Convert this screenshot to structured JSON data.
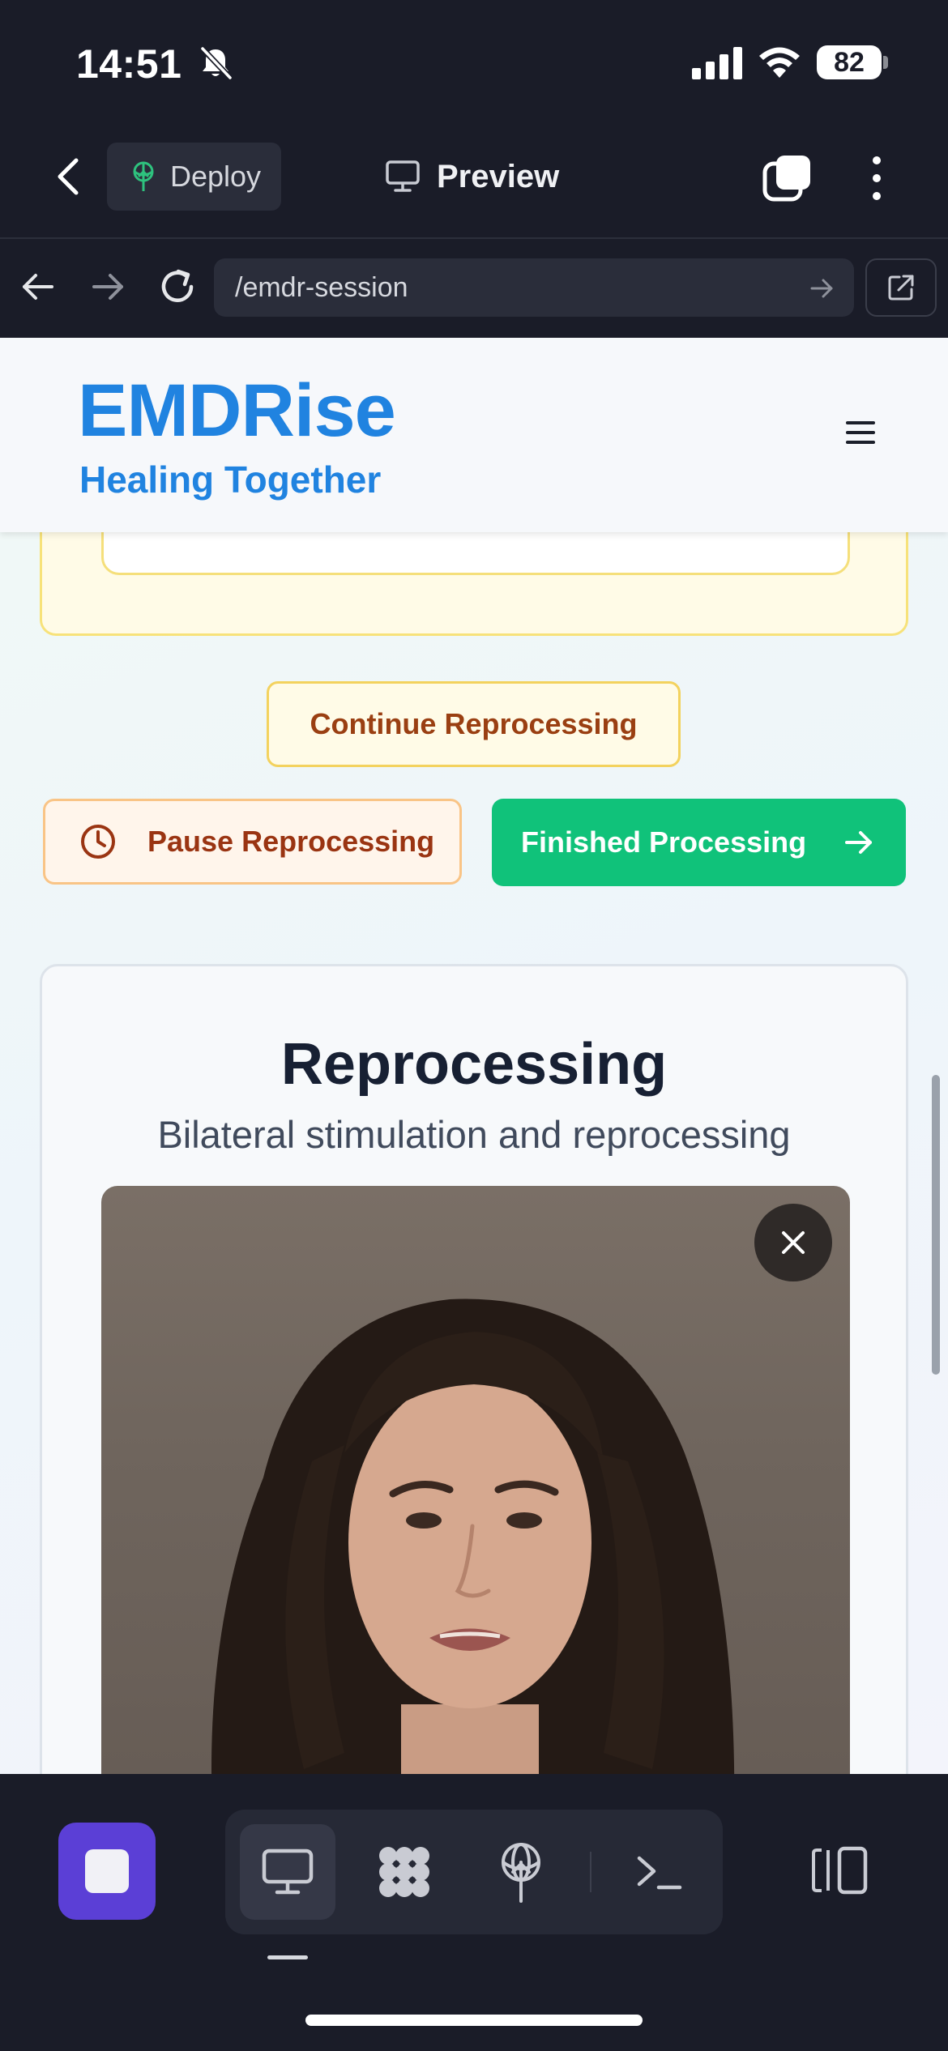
{
  "status_bar": {
    "time": "14:51",
    "battery": "82"
  },
  "toolbar": {
    "deploy_label": "Deploy",
    "preview_label": "Preview"
  },
  "url_bar": {
    "url": "/emdr-session"
  },
  "site": {
    "logo": "EMDRise",
    "tagline": "Healing Together"
  },
  "actions": {
    "continue_label": "Continue Reprocessing",
    "pause_label": "Pause Reprocessing",
    "finished_label": "Finished Processing"
  },
  "reprocessing": {
    "title": "Reprocessing",
    "subtitle": "Bilateral stimulation and reprocessing"
  },
  "colors": {
    "brand_blue": "#2083e0",
    "finished_green": "#10c27a",
    "stop_purple": "#5b3fd6",
    "pause_text": "#9a3412"
  },
  "icons": [
    "bell-slash-icon",
    "signal-icon",
    "wifi-icon",
    "back-icon",
    "deploy-icon",
    "monitor-icon",
    "tabs-icon",
    "more-icon",
    "arrow-left-icon",
    "arrow-right-icon",
    "reload-icon",
    "external-link-icon",
    "hamburger-icon",
    "clock-icon",
    "close-icon",
    "grid-icon",
    "globe-icon",
    "terminal-icon",
    "panel-icon"
  ]
}
